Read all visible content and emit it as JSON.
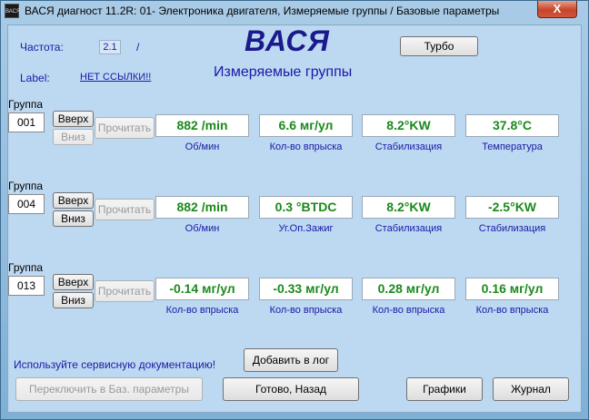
{
  "window": {
    "title": "ВАСЯ диагност 11.2R: 01- Электроника двигателя,  Измеряемые группы / Базовые параметры",
    "icon_text": "ВАСЯ",
    "close_label": "X"
  },
  "header": {
    "freq_label": "Частота:",
    "freq_value": "2.1",
    "freq_sep": "/",
    "label_label": "Label:",
    "label_link": "НЕТ ССЫЛКИ!!",
    "logo": "ВАСЯ",
    "heading": "Измеряемые группы",
    "turbo_label": "Турбо"
  },
  "groups": [
    {
      "title": "Группа",
      "number": "001",
      "up": "Вверх",
      "down": "Вниз",
      "read": "Прочитать",
      "fields": [
        {
          "value": "882 /min",
          "caption": "Об/мин"
        },
        {
          "value": "6.6 мг/ул",
          "caption": "Кол-во впрыска"
        },
        {
          "value": "8.2°KW",
          "caption": "Стабилизация"
        },
        {
          "value": "37.8°C",
          "caption": "Температура"
        }
      ]
    },
    {
      "title": "Группа",
      "number": "004",
      "up": "Вверх",
      "down": "Вниз",
      "read": "Прочитать",
      "fields": [
        {
          "value": "882 /min",
          "caption": "Об/мин"
        },
        {
          "value": "0.3 °BTDC",
          "caption": "Уг.Оп.Зажиг"
        },
        {
          "value": "8.2°KW",
          "caption": "Стабилизация"
        },
        {
          "value": "-2.5°KW",
          "caption": "Стабилизация"
        }
      ]
    },
    {
      "title": "Группа",
      "number": "013",
      "up": "Вверх",
      "down": "Вниз",
      "read": "Прочитать",
      "fields": [
        {
          "value": "-0.14 мг/ул",
          "caption": "Кол-во впрыска"
        },
        {
          "value": "-0.33 мг/ул",
          "caption": "Кол-во впрыска"
        },
        {
          "value": "0.28 мг/ул",
          "caption": "Кол-во впрыска"
        },
        {
          "value": "0.16 мг/ул",
          "caption": "Кол-во впрыска"
        }
      ]
    }
  ],
  "footer": {
    "doc_hint": "Используйте сервисную документацию!",
    "add_log": "Добавить в лог",
    "switch_basic": "Переключить в Баз. параметры",
    "done_back": "Готово, Назад",
    "graphs": "Графики",
    "journal": "Журнал"
  },
  "colors": {
    "value_green": "#1a8a1a",
    "caption_blue": "#1a1aa6",
    "logo_navy": "#1a1a8c",
    "panel_bg": "#bdd8f1"
  }
}
